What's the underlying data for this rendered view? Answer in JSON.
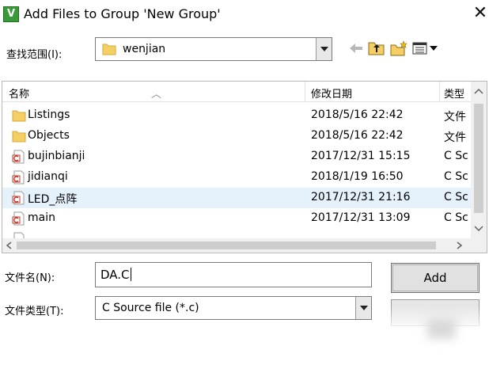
{
  "window": {
    "title": "Add Files to Group 'New Group'",
    "app_icon_letter": "V",
    "close_symbol": "✕"
  },
  "look_in": {
    "label": "查找范围(I):",
    "value": "wenjian"
  },
  "toolbar": {
    "icons": [
      "back-arrow-icon",
      "up-folder-icon",
      "new-folder-icon",
      "view-menu-icon"
    ]
  },
  "file_list": {
    "columns": [
      "名称",
      "修改日期",
      "类型"
    ],
    "rows": [
      {
        "name": "Listings",
        "date": "2018/5/16 22:42",
        "type": "文件",
        "icon": "folder-icon"
      },
      {
        "name": "Objects",
        "date": "2018/5/16 22:42",
        "type": "文件",
        "icon": "folder-icon"
      },
      {
        "name": "bujinbianji",
        "date": "2017/12/31 15:15",
        "type": "C Sc",
        "icon": "c-file-icon"
      },
      {
        "name": "jidianqi",
        "date": "2018/1/19 16:50",
        "type": "C Sc",
        "icon": "c-file-icon"
      },
      {
        "name": "LED_点阵",
        "date": "2017/12/31 21:16",
        "type": "C Sc",
        "icon": "c-file-icon",
        "selected": true
      },
      {
        "name": "main",
        "date": "2017/12/31 13:09",
        "type": "C Sc",
        "icon": "c-file-icon"
      }
    ]
  },
  "file_name": {
    "label": "文件名(N):",
    "value": "DA.C"
  },
  "file_type": {
    "label": "文件类型(T):",
    "value": "C Source file (*.c)"
  },
  "buttons": {
    "add": "Add"
  },
  "colors": {
    "selected_row": "#e5f1fb",
    "folder": "#f5cf63",
    "c_file_red": "#c0392b"
  }
}
